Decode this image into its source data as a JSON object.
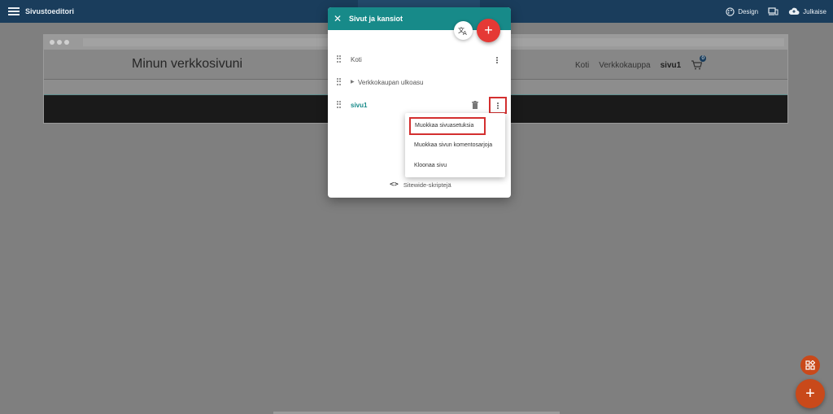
{
  "topbar": {
    "app_title": "Sivustoeditori",
    "design_label": "Design",
    "publish_label": "Julkaise",
    "icons": [
      "menu-icon",
      "palette-icon",
      "devices-icon",
      "cloud-upload-icon"
    ]
  },
  "preview": {
    "site_title": "Minun verkkosivuni",
    "nav": [
      {
        "label": "Koti"
      },
      {
        "label": "Verkkokauppa"
      },
      {
        "label": "sivu1"
      }
    ],
    "cart_count": "0"
  },
  "dialog": {
    "title": "Sivut ja kansiot",
    "pages": [
      {
        "label": "Koti"
      },
      {
        "label": "Verkkokaupan ulkoasu"
      },
      {
        "label": "sivu1"
      }
    ],
    "menu": [
      {
        "label": "Muokkaa sivuasetuksia"
      },
      {
        "label": "Muokkaa sivun komentosarjoja"
      },
      {
        "label": "Kloonaa sivu"
      }
    ],
    "sitewide_label": "Sitewide-skriptejä",
    "sitewide_icon": "<>"
  },
  "colors": {
    "topbar": "#1a3d5c",
    "dialog_header": "#178a89",
    "accent_red": "#e53935",
    "fab": "#c9491a"
  }
}
